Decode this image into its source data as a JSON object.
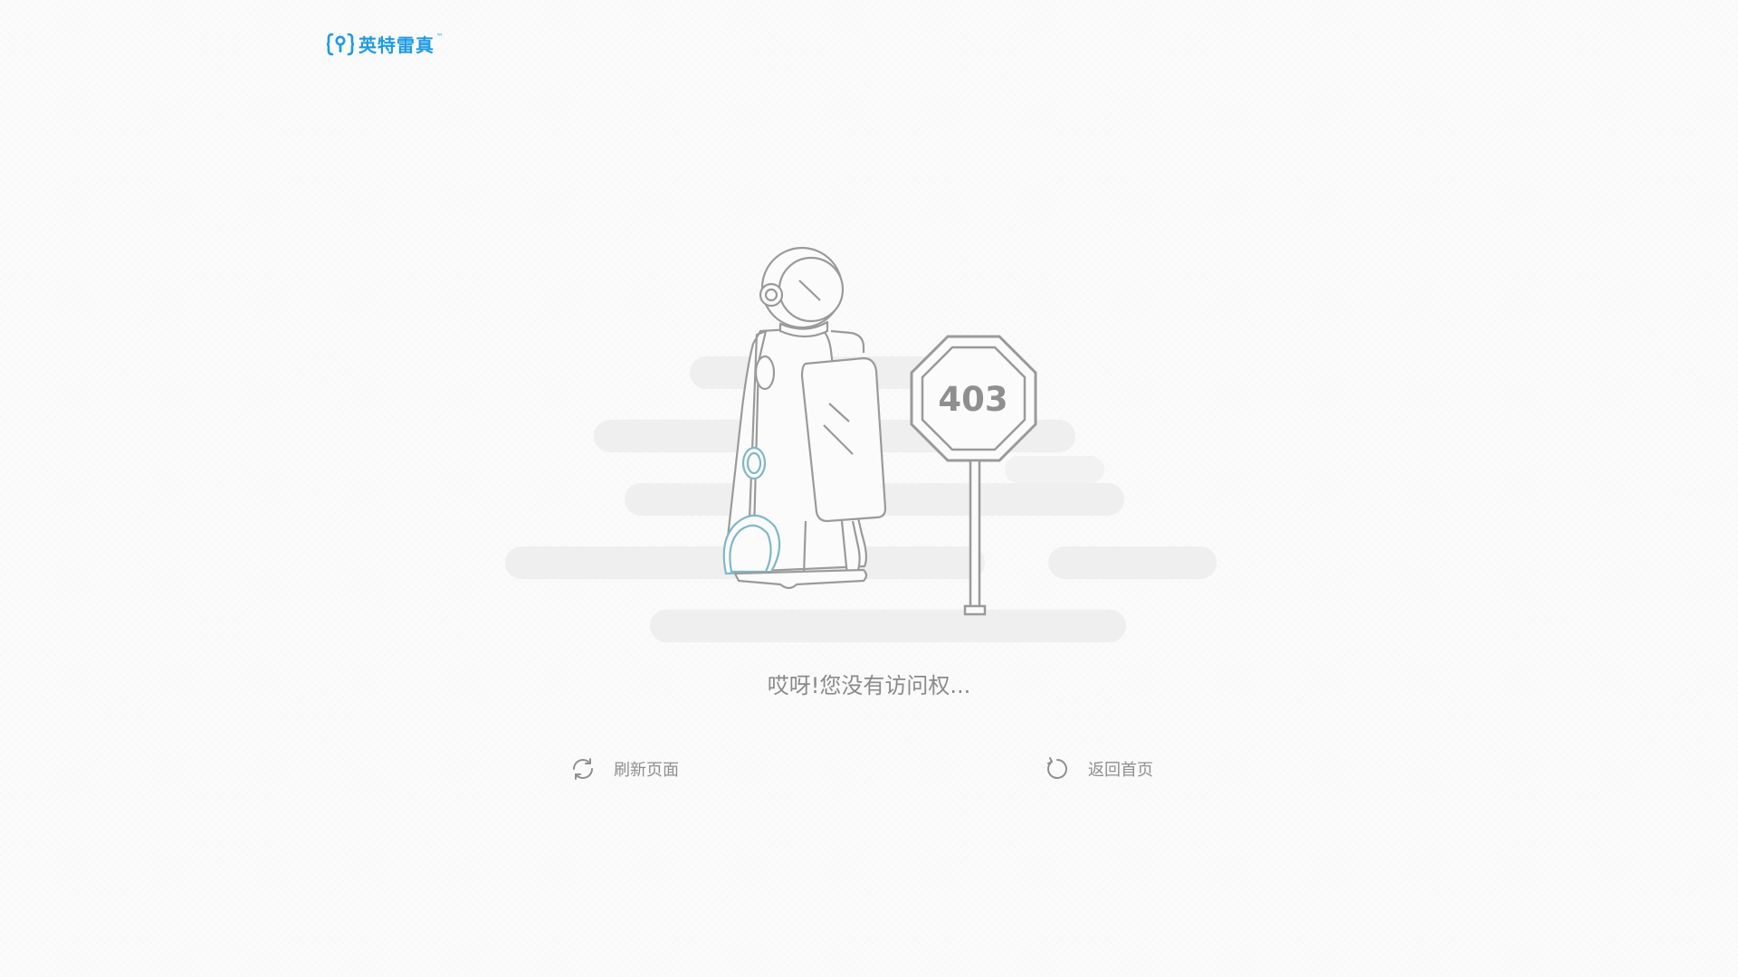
{
  "brand": {
    "name": "英特雷真",
    "trademark": "™",
    "logo_icon": "brand-bracket-mark-icon",
    "accent_color": "#1e9be6"
  },
  "error": {
    "code": "403",
    "message": "哎呀!您没有访问权...",
    "illustration": "robot-with-stop-sign"
  },
  "actions": {
    "refresh": {
      "label": "刷新页面",
      "icon": "refresh-icon"
    },
    "home": {
      "label": "返回首页",
      "icon": "rotate-back-icon"
    }
  },
  "colors": {
    "text_muted": "#8a8a8a",
    "robot_accent": "#7fb7c9",
    "cloud": "#efefef",
    "sign_stroke": "#9a9a9a"
  }
}
